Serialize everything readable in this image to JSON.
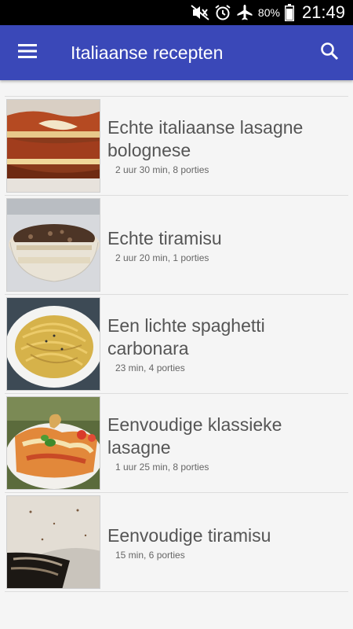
{
  "status_bar": {
    "battery_percent": "80%",
    "time": "21:49",
    "icons": [
      "mute-icon",
      "alarm-icon",
      "airplane-mode-icon",
      "battery-icon"
    ]
  },
  "app_bar": {
    "title": "Italiaanse recepten",
    "menu_icon": "hamburger-menu-icon",
    "search_icon": "search-icon",
    "color": "#3a48b8"
  },
  "recipes": [
    {
      "title_line1": "Echte italiaanse lasagne",
      "title_line2": "bolognese",
      "meta": "2 uur 30 min, 8 porties"
    },
    {
      "title_line1": "Echte tiramisu",
      "title_line2": "",
      "meta": "2 uur 20 min, 1 porties"
    },
    {
      "title_line1": "Een lichte spaghetti",
      "title_line2": "carbonara",
      "meta": "23 min, 4 porties"
    },
    {
      "title_line1": "Eenvoudige klassieke",
      "title_line2": "lasagne",
      "meta": "1 uur 25 min, 8 porties"
    },
    {
      "title_line1": "Eenvoudige tiramisu",
      "title_line2": "",
      "meta": "15 min, 6 porties"
    }
  ]
}
